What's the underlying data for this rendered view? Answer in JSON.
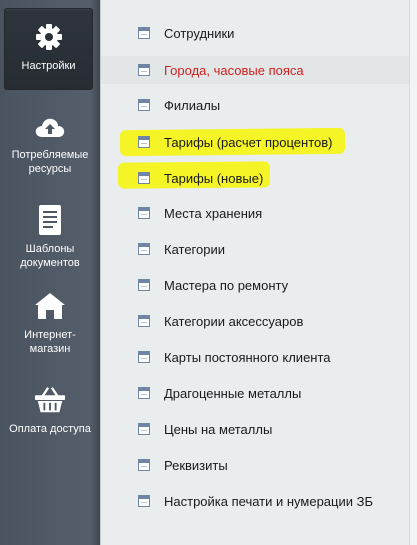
{
  "sidebar": {
    "items": [
      {
        "label": "Настройки",
        "icon": "gear-icon",
        "active": true
      },
      {
        "label": "Потребляемые ресурсы",
        "icon": "cloud-upload-icon"
      },
      {
        "label": "Шаблоны документов",
        "icon": "document-icon"
      },
      {
        "label": "Интернет-магазин",
        "icon": "home-icon"
      },
      {
        "label": "Оплата доступа",
        "icon": "basket-icon"
      }
    ]
  },
  "menu": {
    "items": [
      {
        "label": "Сотрудники"
      },
      {
        "label": "Города, часовые пояса"
      },
      {
        "label": "Филиалы"
      },
      {
        "label": "Тарифы (расчет процентов)"
      },
      {
        "label": "Тарифы (новые)"
      },
      {
        "label": "Места хранения"
      },
      {
        "label": "Категории"
      },
      {
        "label": "Мастера по ремонту"
      },
      {
        "label": "Категории аксессуаров"
      },
      {
        "label": "Карты постоянного клиента"
      },
      {
        "label": "Драгоценные металлы"
      },
      {
        "label": "Цены на металлы"
      },
      {
        "label": "Реквизиты"
      },
      {
        "label": "Настройка печати и нумерации ЗБ"
      }
    ]
  },
  "colors": {
    "highlight": "#f4f41a",
    "link_red": "#cf1f1f",
    "sidebar_bg": "#4a5360"
  }
}
